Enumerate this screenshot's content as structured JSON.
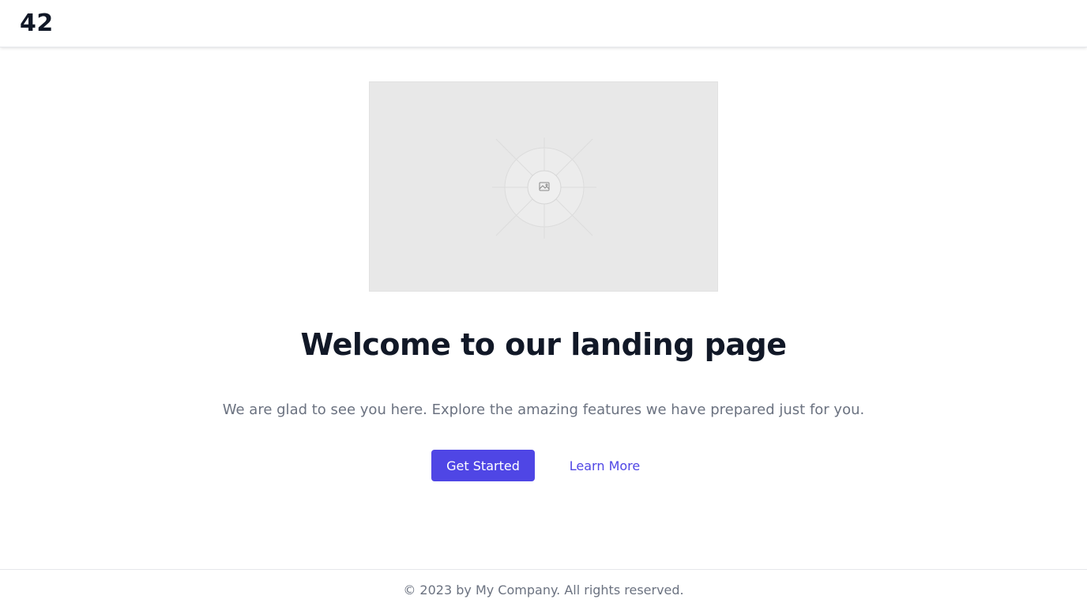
{
  "header": {
    "logo_text": "42"
  },
  "hero": {
    "image_icon": "image-placeholder-icon",
    "title": "Welcome to our landing page",
    "subtitle": "We are glad to see you here. Explore the amazing features we have prepared just for you.",
    "primary_button_label": "Get Started",
    "secondary_button_label": "Learn More"
  },
  "footer": {
    "copyright": "© 2023 by My Company. All rights reserved."
  },
  "colors": {
    "accent": "#4f46e5",
    "heading": "#111827",
    "muted_text": "#6b7280",
    "placeholder_bg": "#e8e8e8"
  }
}
